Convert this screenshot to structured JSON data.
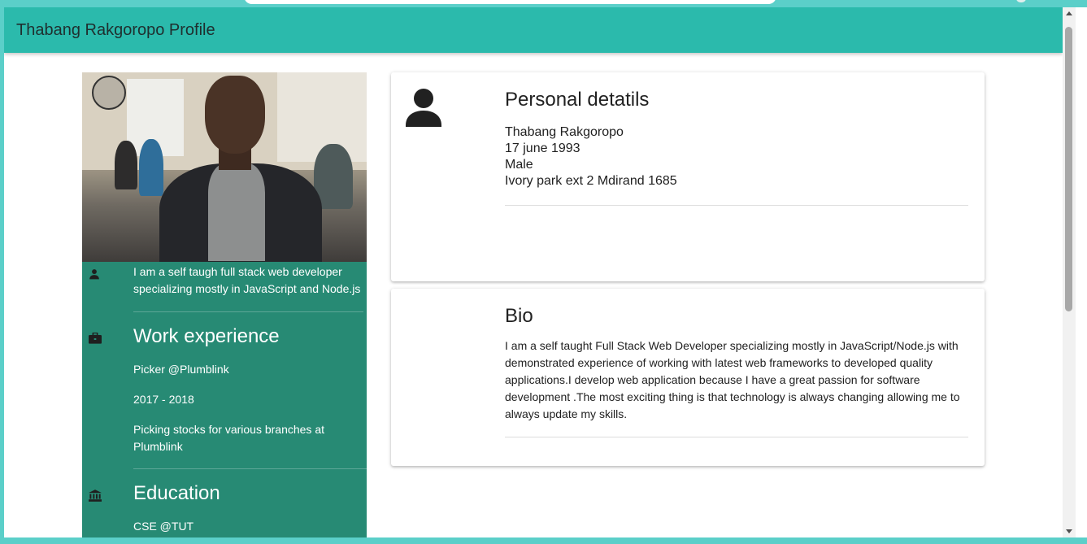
{
  "app": {
    "title": "Thabang Rakgoropo Profile"
  },
  "sidebar": {
    "about": "I am a self taugh full stack web developer specializing mostly in JavaScript and Node.js",
    "work": {
      "title": "Work experience",
      "role": "Picker @Plumblink",
      "years": "2017 - 2018",
      "description": "Picking stocks for various branches at Plumblink"
    },
    "education": {
      "title": "Education",
      "item": "CSE @TUT"
    }
  },
  "personal": {
    "title": "Personal detatils",
    "name": "Thabang Rakgoropo",
    "dob": "17 june 1993",
    "gender": "Male",
    "address": "Ivory park ext 2 Mdirand 1685"
  },
  "bio": {
    "title": "Bio",
    "text": "I am a self taught Full Stack Web Developer specializing mostly in JavaScript/Node.js with demonstrated experience of working with latest web frameworks to developed quality applications.I develop web application because I have a great passion for software development .The most exciting thing is that technology is always changing allowing me to always update my skills."
  },
  "colors": {
    "appbar": "#2bbaac",
    "sidebar": "#278a74",
    "background": "#5bcfc9"
  },
  "icons": [
    "person-icon",
    "briefcase-icon",
    "bank-icon",
    "account-icon"
  ]
}
